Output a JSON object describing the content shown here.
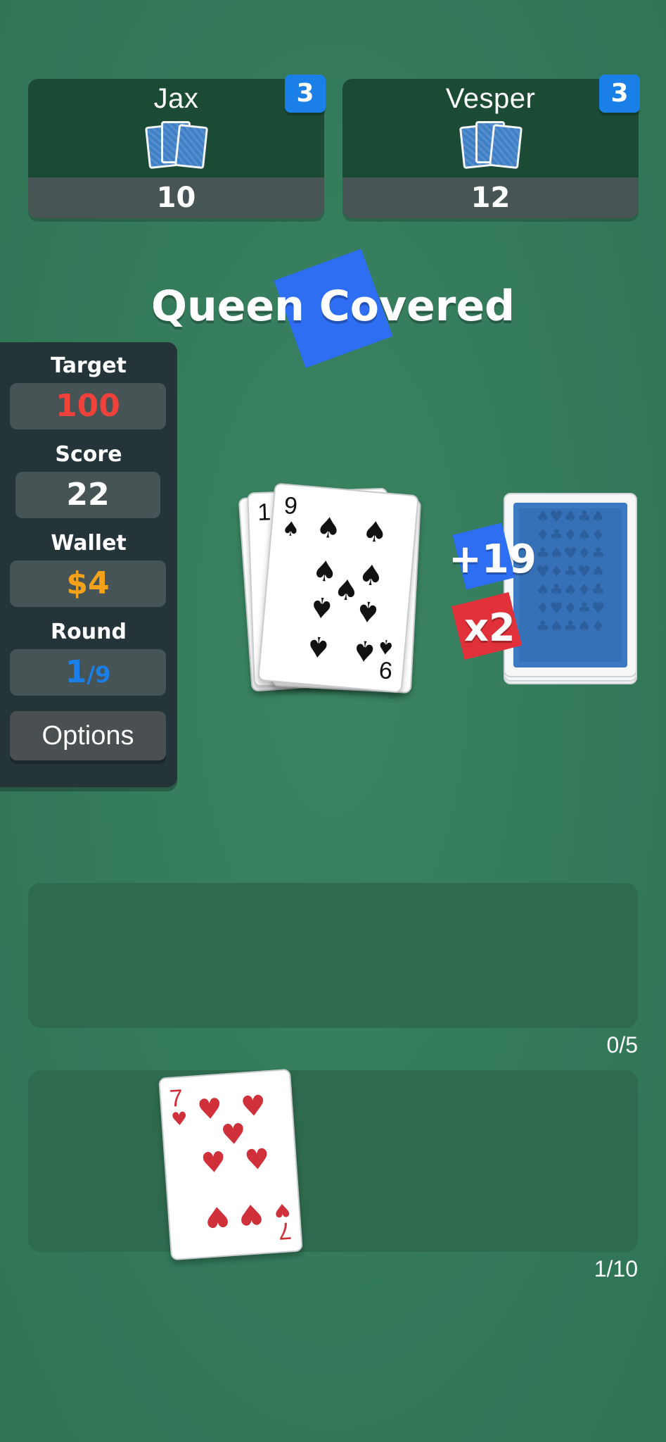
{
  "opponents": [
    {
      "name": "Jax",
      "score": "10",
      "badge": "3"
    },
    {
      "name": "Vesper",
      "score": "12",
      "badge": "3"
    }
  ],
  "event": {
    "text": "Queen Covered"
  },
  "panel": {
    "target_label": "Target",
    "target_value": "100",
    "score_label": "Score",
    "score_value": "22",
    "wallet_label": "Wallet",
    "wallet_value": "$4",
    "round_label": "Round",
    "round_current": "1",
    "round_separator": "/",
    "round_total": "9",
    "options_label": "Options"
  },
  "pile": {
    "top_card_rank": "9",
    "top_card_suit": "spade",
    "under_corner_top": "1",
    "under_corner_bottom": "9"
  },
  "bonus": {
    "plus": "+19",
    "multiplier": "x2"
  },
  "play_zone": {
    "count": "0/5"
  },
  "hand": {
    "count": "1/10",
    "card_rank": "7",
    "card_suit": "heart"
  },
  "colors": {
    "felt": "#347b59",
    "target": "#f0413a",
    "wallet": "#f5a21b",
    "round": "#1a7fe6",
    "badge": "#1a7fe6",
    "event_shape": "#2e6ef3",
    "multiplier": "#e0303a"
  }
}
